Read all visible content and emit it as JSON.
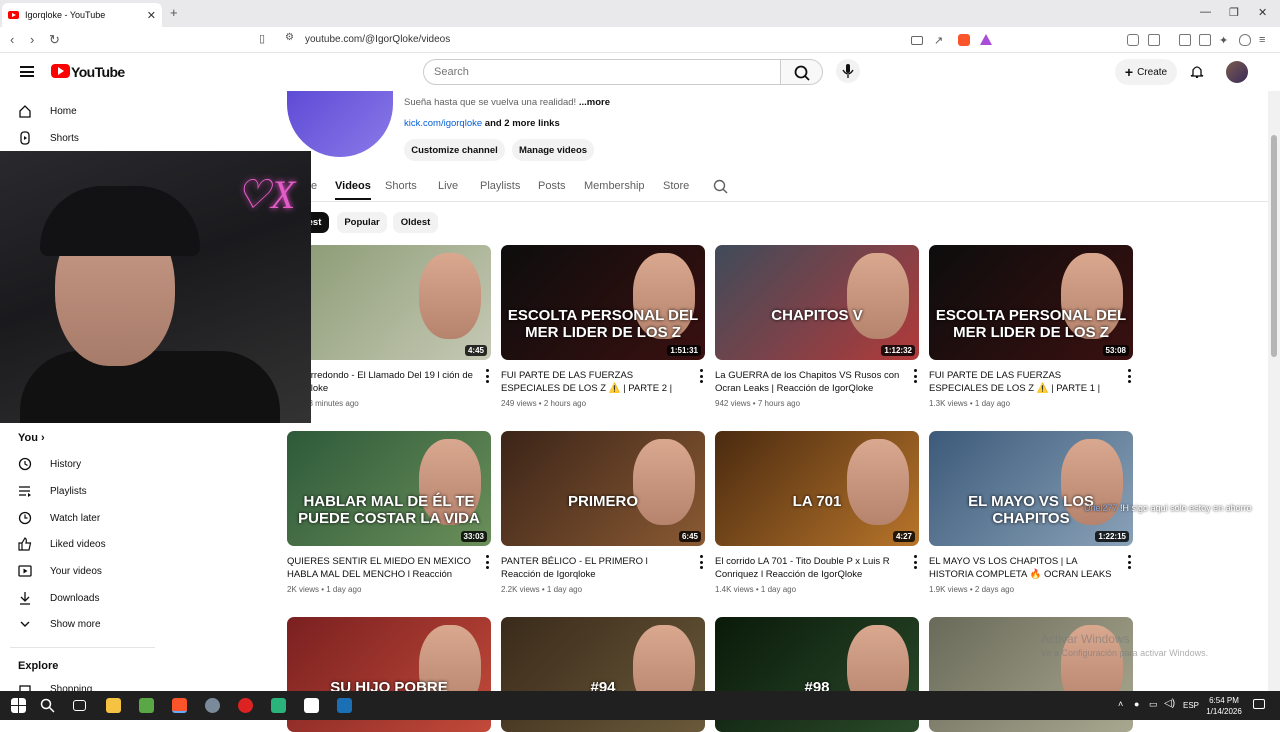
{
  "browser": {
    "tab_title": "Igorqloke - YouTube",
    "url": "youtube.com/@IgorQloke/videos"
  },
  "youtube": {
    "logo_text": "YouTube",
    "search_placeholder": "Search",
    "create_label": "Create"
  },
  "sidebar": {
    "top": [
      {
        "label": "Home",
        "icon": "home-icon"
      },
      {
        "label": "Shorts",
        "icon": "shorts-icon"
      }
    ],
    "you_header": "You",
    "you_items": [
      {
        "label": "History",
        "icon": "history-icon"
      },
      {
        "label": "Playlists",
        "icon": "playlists-icon"
      },
      {
        "label": "Watch later",
        "icon": "watch-later-icon"
      },
      {
        "label": "Liked videos",
        "icon": "like-icon"
      },
      {
        "label": "Your videos",
        "icon": "your-videos-icon"
      },
      {
        "label": "Downloads",
        "icon": "download-icon"
      },
      {
        "label": "Show more",
        "icon": "chevron-down-icon"
      }
    ],
    "explore_header": "Explore",
    "explore_items": [
      {
        "label": "Shopping",
        "icon": "shopping-icon"
      }
    ]
  },
  "channel": {
    "description_text": "Sueña hasta que se vuelva una realidad!",
    "more_label": "...more",
    "link_text": "kick.com/igorqloke",
    "more_links": "and 2 more links",
    "customize_button": "Customize channel",
    "manage_button": "Manage videos",
    "tabs": [
      "e",
      "Videos",
      "Shorts",
      "Live",
      "Playlists",
      "Posts",
      "Membership",
      "Store"
    ],
    "active_tab": "Videos",
    "chips": [
      "est",
      "Popular",
      "Oldest"
    ]
  },
  "videos": [
    {
      "title": "nito Arredondo - El Llamado Del 19 l ción de IgorQloke",
      "meta": "ws • 13 minutes ago",
      "duration": "4:45",
      "thumb_text": "",
      "colors": [
        "#8a9a73",
        "#c6c9b5"
      ]
    },
    {
      "title": "FUI PARTE DE LAS FUERZAS ESPECIALES DE LOS Z ⚠️ | PARTE 2 | REACCIÓN DE...",
      "meta": "249 views • 2 hours ago",
      "duration": "1:51:31",
      "thumb_text": "ESCOLTA PERSONAL DEL MER LIDER DE LOS Z",
      "colors": [
        "#0d0d0d",
        "#3a1010"
      ]
    },
    {
      "title": "La GUERRA de los Chapitos VS Rusos con Ocran Leaks | Reacción de IgorQloke",
      "meta": "942 views • 7 hours ago",
      "duration": "1:12:32",
      "thumb_text": "CHAPITOS V",
      "colors": [
        "#3f4b5a",
        "#b23a3a"
      ]
    },
    {
      "title": "FUI PARTE DE LAS FUERZAS ESPECIALES DE LOS Z ⚠️ | PARTE 1 | REACCIÓN DE...",
      "meta": "1.3K views • 1 day ago",
      "duration": "53:08",
      "thumb_text": "ESCOLTA PERSONAL DEL MER LIDER DE LOS Z",
      "colors": [
        "#0d0d0d",
        "#3a1010"
      ]
    },
    {
      "title": "QUIERES SENTIR EL MIEDO EN MEXICO HABLA MAL DEL MENCHO l Reacción de...",
      "meta": "2K views • 1 day ago",
      "duration": "33:03",
      "thumb_text": "HABLAR MAL DE ÉL TE PUEDE COSTAR LA VIDA",
      "colors": [
        "#2e5a3a",
        "#6b8f5a"
      ]
    },
    {
      "title": "PANTER BÉLICO - EL PRIMERO l Reacción de Igorqloke",
      "meta": "2.2K views • 1 day ago",
      "duration": "6:45",
      "thumb_text": "PRIMERO",
      "colors": [
        "#3b2418",
        "#8a5a33"
      ]
    },
    {
      "title": "El corrido LA 701 - Tito Double P x Luis R Conriquez l Reacción de IgorQloke",
      "meta": "1.4K views • 1 day ago",
      "duration": "4:27",
      "thumb_text": "LA 701",
      "colors": [
        "#4a2a10",
        "#b8752a"
      ]
    },
    {
      "title": "EL MAYO VS LOS CHAPITOS | LA HISTORIA COMPLETA 🔥 OCRAN LEAKS | REACCIÓN...",
      "meta": "1.9K views • 2 days ago",
      "duration": "1:22:15",
      "thumb_text": "EL MAYO VS LOS CHAPITOS",
      "colors": [
        "#3c5a7a",
        "#8aa2b8"
      ]
    },
    {
      "title": "",
      "meta": "",
      "duration": "",
      "thumb_text": "SU HIJO POBRE",
      "colors": [
        "#7a2020",
        "#c24a3a"
      ]
    },
    {
      "title": "",
      "meta": "",
      "duration": "",
      "thumb_text": "#94",
      "colors": [
        "#3a2a1a",
        "#6a5a3a"
      ]
    },
    {
      "title": "",
      "meta": "",
      "duration": "",
      "thumb_text": "#98",
      "colors": [
        "#0a1a0a",
        "#2a4a2a"
      ]
    },
    {
      "title": "",
      "meta": "",
      "duration": "",
      "thumb_text": "",
      "colors": [
        "#6a6a5a",
        "#a8a890"
      ]
    }
  ],
  "overlay": {
    "chat_user": "Uriel277",
    "chat_text": "!H sigo aqui solo estoy en ahorro",
    "watermark_title": "Activar Windows",
    "watermark_sub": "Ve a Configuración para activar Windows."
  },
  "taskbar": {
    "lang": "ESP",
    "time": "6:54 PM",
    "date": "1/14/2026"
  }
}
